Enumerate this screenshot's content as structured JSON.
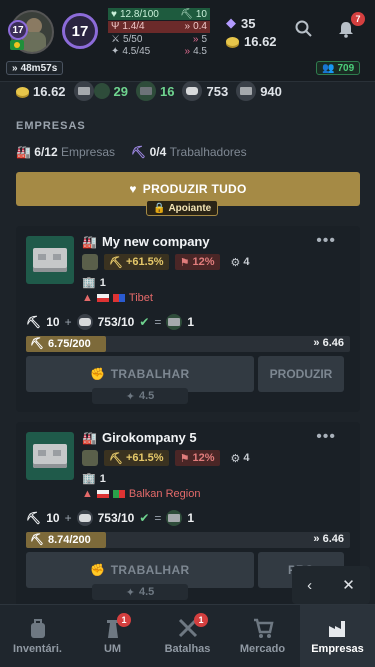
{
  "header": {
    "avatar_level": "17",
    "level": "17",
    "stats": [
      {
        "left": "12.8/100",
        "right": "10",
        "left_icon": "heart-icon",
        "right_icon": "pickaxe-icon"
      },
      {
        "left": "1.4/4",
        "right": "0.4",
        "left_icon": "food-icon",
        "right_icon": "chevrons-up-icon"
      },
      {
        "left": "5/50",
        "right": "5",
        "left_icon": "swords-icon",
        "right_icon": "chevrons-up-icon"
      },
      {
        "left": "4.5/45",
        "right": "4.5",
        "left_icon": "bulb-icon",
        "right_icon": "chevrons-up-icon"
      }
    ],
    "gems": "35",
    "gold": "16.62",
    "notifications": "7",
    "timer": "48m57s",
    "online": "709"
  },
  "inventory": [
    {
      "value": "16.62",
      "icon": "gold-coin-icon"
    },
    {
      "value": "29",
      "icon": "gray-brick-icon",
      "highlight": true
    },
    {
      "value": "16",
      "icon": "dark-brick-icon",
      "highlight": true
    },
    {
      "value": "753",
      "icon": "stone-icon"
    },
    {
      "value": "940",
      "icon": "steel-block-icon"
    }
  ],
  "section": {
    "title": "EMPRESAS",
    "companies_count": "6/12",
    "companies_label": "Empresas",
    "workers_count": "0/4",
    "workers_label": "Trabalhadores"
  },
  "produce_all": {
    "label": "PRODUZIR TUDO",
    "badge": "Apoiante"
  },
  "companies": [
    {
      "name": "My new company",
      "bonus": "+61.5%",
      "tax": "12%",
      "level": "4",
      "workers": "1",
      "region": "Tibet",
      "recipe_workers": "10",
      "recipe_input": "753/10",
      "recipe_output": "1",
      "progress_text": "6.75/200",
      "progress": 0.034,
      "production_rate": "6.46",
      "work_label": "TRABALHAR",
      "produce_label": "PRODUZIR",
      "energy_cost": "4.5"
    },
    {
      "name": "Girokompany 5",
      "bonus": "+61.5%",
      "tax": "12%",
      "level": "4",
      "workers": "1",
      "region": "Balkan Region",
      "recipe_workers": "10",
      "recipe_input": "753/10",
      "recipe_output": "1",
      "progress_text": "8.74/200",
      "progress": 0.044,
      "production_rate": "6.46",
      "work_label": "TRABALHAR",
      "produce_label": "PRO",
      "energy_cost": "4.5"
    }
  ],
  "bottom_nav": [
    {
      "label": "Inventári.",
      "icon": "backpack-icon",
      "badge": ""
    },
    {
      "label": "UM",
      "icon": "tower-icon",
      "badge": "1"
    },
    {
      "label": "Batalhas",
      "icon": "crossed-swords-icon",
      "badge": "1"
    },
    {
      "label": "Mercado",
      "icon": "cart-icon",
      "badge": ""
    },
    {
      "label": "Empresas",
      "icon": "factory-icon",
      "badge": "",
      "active": true
    }
  ]
}
